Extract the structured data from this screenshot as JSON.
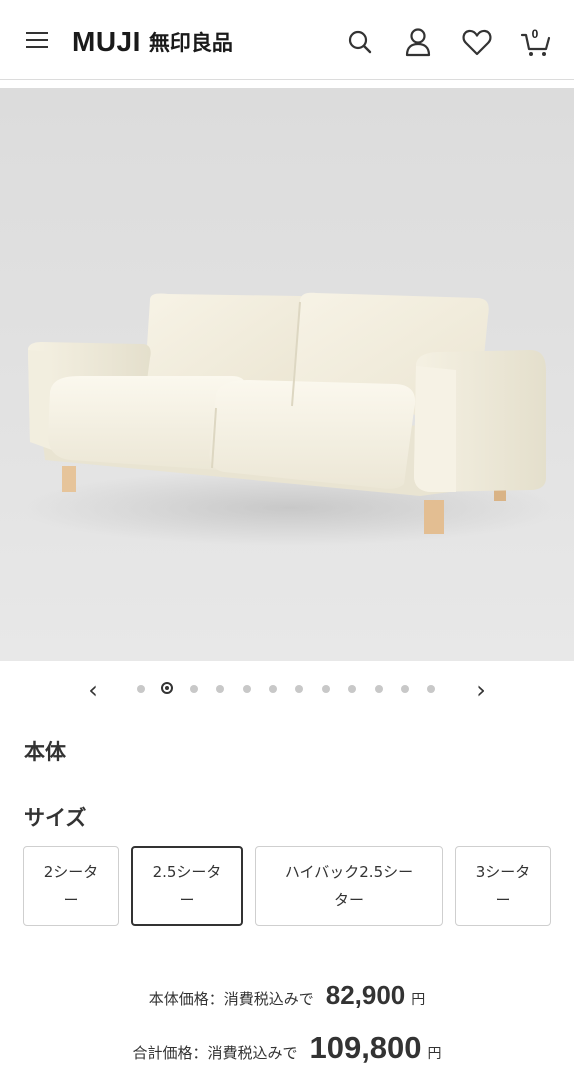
{
  "header": {
    "logo_en": "MUJI",
    "logo_jp": "無印良品",
    "cart_count": "0",
    "icons": [
      "menu-icon",
      "search-icon",
      "account-icon",
      "heart-icon",
      "cart-icon"
    ]
  },
  "hero": {
    "image": "sofa-image"
  },
  "carousel": {
    "prev_icon": "chevron-left-icon",
    "next_icon": "chevron-right-icon",
    "total_slides": 12,
    "active_slide": 2
  },
  "sections": {
    "body_title": "本体",
    "size_title": "サイズ"
  },
  "sizes": [
    {
      "line1": "2シータ",
      "line2": "ー",
      "selected": false
    },
    {
      "line1": "2.5シータ",
      "line2": "ー",
      "selected": true
    },
    {
      "line1": "ハイバック2.5シー",
      "line2": "ター",
      "selected": false
    },
    {
      "line1": "3シータ",
      "line2": "ー",
      "selected": false
    }
  ],
  "prices": {
    "body_label": "本体価格：消費税込みで",
    "body_value": "82,900",
    "total_label": "合計価格：消費税込みで",
    "total_value": "109,800",
    "currency": "円"
  }
}
